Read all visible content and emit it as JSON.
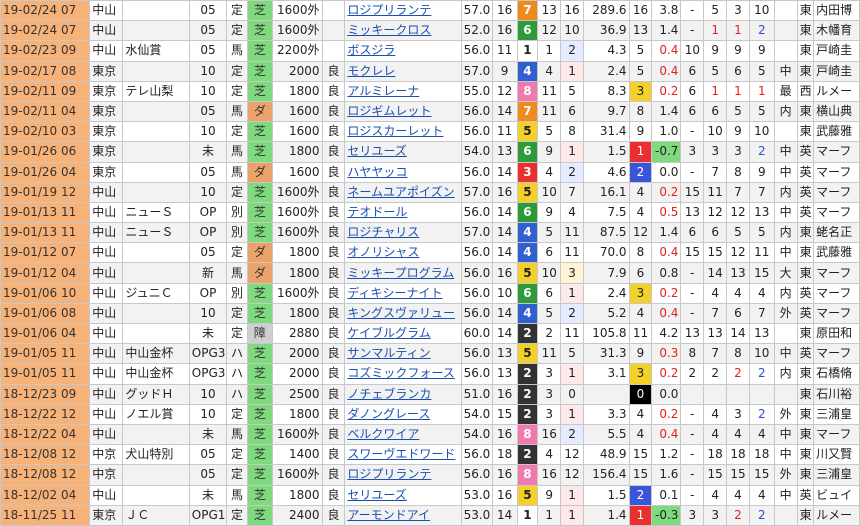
{
  "rows": [
    {
      "date": "19-02/24 07",
      "venue": "中山",
      "race": "",
      "cls": "05",
      "cond": "定",
      "surf": "芝",
      "surf_type": "turf",
      "dist": "1600外",
      "going": "",
      "horse": "ロジプリランテ",
      "wt": "57.0",
      "field": "16",
      "gate": "7",
      "no": "13",
      "pop": "16",
      "odds": "289.6",
      "fin": "16",
      "diff": "3.8",
      "p1": "-",
      "p2": "5",
      "p3": "3",
      "p4": "10",
      "style": "",
      "region": "東",
      "jockey": "内田博"
    },
    {
      "date": "19-02/24 07",
      "venue": "中山",
      "race": "",
      "cls": "05",
      "cond": "定",
      "surf": "芝",
      "surf_type": "turf",
      "dist": "1600外",
      "going": "",
      "horse": "ミッキークロス",
      "wt": "52.0",
      "field": "16",
      "gate": "6",
      "no": "12",
      "pop": "10",
      "odds": "36.9",
      "fin": "13",
      "diff": "1.4",
      "p1": "-",
      "p2": "1",
      "p3": "1",
      "p4": "2",
      "style": "",
      "region": "東",
      "jockey": "木幡育"
    },
    {
      "date": "19-02/23 09",
      "venue": "中山",
      "race": "水仙賞",
      "cls": "05",
      "cond": "馬",
      "surf": "芝",
      "surf_type": "turf",
      "dist": "2200外",
      "going": "",
      "horse": "ボスジラ",
      "wt": "56.0",
      "field": "11",
      "gate": "1",
      "no": "1",
      "pop": "2",
      "odds": "4.3",
      "fin": "5",
      "diff": "0.4",
      "p1": "10",
      "p2": "9",
      "p3": "9",
      "p4": "9",
      "style": "",
      "region": "東",
      "jockey": "戸崎圭"
    },
    {
      "date": "19-02/17 08",
      "venue": "東京",
      "race": "",
      "cls": "10",
      "cond": "定",
      "surf": "芝",
      "surf_type": "turf",
      "dist": "2000",
      "going": "良",
      "horse": "モクレレ",
      "wt": "57.0",
      "field": "9",
      "gate": "4",
      "no": "4",
      "pop": "1",
      "odds": "2.4",
      "fin": "5",
      "diff": "0.4",
      "p1": "6",
      "p2": "5",
      "p3": "6",
      "p4": "5",
      "style": "中",
      "region": "東",
      "jockey": "戸崎圭"
    },
    {
      "date": "19-02/11 09",
      "venue": "東京",
      "race": "テレ山梨",
      "cls": "10",
      "cond": "定",
      "surf": "芝",
      "surf_type": "turf",
      "dist": "1800",
      "going": "良",
      "horse": "アルミレーナ",
      "wt": "55.0",
      "field": "12",
      "gate": "8",
      "no": "11",
      "pop": "5",
      "odds": "8.3",
      "fin": "3",
      "diff": "0.2",
      "p1": "6",
      "p2": "1",
      "p3": "1",
      "p4": "1",
      "style": "最",
      "region": "西",
      "jockey": "ルメー"
    },
    {
      "date": "19-02/11 04",
      "venue": "東京",
      "race": "",
      "cls": "05",
      "cond": "馬",
      "surf": "ダ",
      "surf_type": "dirt",
      "dist": "1600",
      "going": "良",
      "horse": "ロジギムレット",
      "wt": "56.0",
      "field": "14",
      "gate": "7",
      "no": "11",
      "pop": "6",
      "odds": "9.7",
      "fin": "8",
      "diff": "1.4",
      "p1": "6",
      "p2": "6",
      "p3": "5",
      "p4": "5",
      "style": "内",
      "region": "東",
      "jockey": "横山典"
    },
    {
      "date": "19-02/10 03",
      "venue": "東京",
      "race": "",
      "cls": "10",
      "cond": "定",
      "surf": "芝",
      "surf_type": "turf",
      "dist": "1600",
      "going": "良",
      "horse": "ロジスカーレット",
      "wt": "56.0",
      "field": "11",
      "gate": "5",
      "no": "5",
      "pop": "8",
      "odds": "31.4",
      "fin": "9",
      "diff": "1.0",
      "p1": "-",
      "p2": "10",
      "p3": "9",
      "p4": "10",
      "style": "",
      "region": "東",
      "jockey": "武藤雅"
    },
    {
      "date": "19-01/26 06",
      "venue": "東京",
      "race": "",
      "cls": "未",
      "cond": "馬",
      "surf": "芝",
      "surf_type": "turf",
      "dist": "1800",
      "going": "良",
      "horse": "セリユーズ",
      "wt": "54.0",
      "field": "13",
      "gate": "6",
      "no": "9",
      "pop": "1",
      "odds": "1.5",
      "fin": "1",
      "diff": "-0.7",
      "p1": "3",
      "p2": "3",
      "p3": "3",
      "p4": "2",
      "style": "中",
      "region": "英",
      "jockey": "マーフ"
    },
    {
      "date": "19-01/26 04",
      "venue": "東京",
      "race": "",
      "cls": "05",
      "cond": "馬",
      "surf": "ダ",
      "surf_type": "dirt",
      "dist": "1600",
      "going": "良",
      "horse": "ハヤヤッコ",
      "wt": "56.0",
      "field": "14",
      "gate": "3",
      "no": "4",
      "pop": "2",
      "odds": "4.6",
      "fin": "2",
      "diff": "0.0",
      "p1": "-",
      "p2": "7",
      "p3": "8",
      "p4": "9",
      "style": "中",
      "region": "英",
      "jockey": "マーフ"
    },
    {
      "date": "19-01/19 12",
      "venue": "中山",
      "race": "",
      "cls": "10",
      "cond": "定",
      "surf": "芝",
      "surf_type": "turf",
      "dist": "1600外",
      "going": "良",
      "horse": "ネームユアポイズン",
      "wt": "57.0",
      "field": "16",
      "gate": "5",
      "no": "10",
      "pop": "7",
      "odds": "16.1",
      "fin": "4",
      "diff": "0.2",
      "p1": "15",
      "p2": "11",
      "p3": "7",
      "p4": "7",
      "style": "内",
      "region": "英",
      "jockey": "マーフ"
    },
    {
      "date": "19-01/13 11",
      "venue": "中山",
      "race": "ニューＳ",
      "cls": "OP",
      "cond": "別",
      "surf": "芝",
      "surf_type": "turf",
      "dist": "1600外",
      "going": "良",
      "horse": "テオドール",
      "wt": "56.0",
      "field": "14",
      "gate": "6",
      "no": "9",
      "pop": "4",
      "odds": "7.5",
      "fin": "4",
      "diff": "0.5",
      "p1": "13",
      "p2": "12",
      "p3": "12",
      "p4": "13",
      "style": "中",
      "region": "英",
      "jockey": "マーフ"
    },
    {
      "date": "19-01/13 11",
      "venue": "中山",
      "race": "ニューＳ",
      "cls": "OP",
      "cond": "別",
      "surf": "芝",
      "surf_type": "turf",
      "dist": "1600外",
      "going": "良",
      "horse": "ロジチャリス",
      "wt": "57.0",
      "field": "14",
      "gate": "4",
      "no": "5",
      "pop": "11",
      "odds": "87.5",
      "fin": "12",
      "diff": "1.4",
      "p1": "6",
      "p2": "6",
      "p3": "5",
      "p4": "5",
      "style": "内",
      "region": "東",
      "jockey": "蛯名正"
    },
    {
      "date": "19-01/12 07",
      "venue": "中山",
      "race": "",
      "cls": "05",
      "cond": "定",
      "surf": "ダ",
      "surf_type": "dirt",
      "dist": "1800",
      "going": "良",
      "horse": "オノリシャス",
      "wt": "56.0",
      "field": "14",
      "gate": "4",
      "no": "6",
      "pop": "11",
      "odds": "70.0",
      "fin": "8",
      "diff": "0.4",
      "p1": "15",
      "p2": "15",
      "p3": "12",
      "p4": "11",
      "style": "中",
      "region": "東",
      "jockey": "武藤雅"
    },
    {
      "date": "19-01/12 04",
      "venue": "中山",
      "race": "",
      "cls": "新",
      "cond": "馬",
      "surf": "ダ",
      "surf_type": "dirt",
      "dist": "1800",
      "going": "良",
      "horse": "ミッキープログラム",
      "wt": "56.0",
      "field": "16",
      "gate": "5",
      "no": "10",
      "pop": "3",
      "odds": "7.9",
      "fin": "6",
      "diff": "0.8",
      "p1": "-",
      "p2": "14",
      "p3": "13",
      "p4": "15",
      "style": "大",
      "region": "東",
      "jockey": "マーフ"
    },
    {
      "date": "19-01/06 10",
      "venue": "中山",
      "race": "ジュニＣ",
      "cls": "OP",
      "cond": "別",
      "surf": "芝",
      "surf_type": "turf",
      "dist": "1600外",
      "going": "良",
      "horse": "ディキシーナイト",
      "wt": "56.0",
      "field": "10",
      "gate": "6",
      "no": "6",
      "pop": "1",
      "odds": "2.4",
      "fin": "3",
      "diff": "0.2",
      "p1": "-",
      "p2": "4",
      "p3": "4",
      "p4": "4",
      "style": "内",
      "region": "英",
      "jockey": "マーフ"
    },
    {
      "date": "19-01/06 08",
      "venue": "中山",
      "race": "",
      "cls": "10",
      "cond": "定",
      "surf": "芝",
      "surf_type": "turf",
      "dist": "1800",
      "going": "良",
      "horse": "キングスヴァリュー",
      "wt": "56.0",
      "field": "14",
      "gate": "4",
      "no": "5",
      "pop": "2",
      "odds": "5.2",
      "fin": "4",
      "diff": "0.4",
      "p1": "-",
      "p2": "7",
      "p3": "6",
      "p4": "7",
      "style": "外",
      "region": "英",
      "jockey": "マーフ"
    },
    {
      "date": "19-01/06 04",
      "venue": "中山",
      "race": "",
      "cls": "未",
      "cond": "定",
      "surf": "障",
      "surf_type": "jump",
      "dist": "2880",
      "going": "良",
      "horse": "ケイブルグラム",
      "wt": "60.0",
      "field": "14",
      "gate": "2",
      "no": "2",
      "pop": "11",
      "odds": "105.8",
      "fin": "11",
      "diff": "4.2",
      "p1": "13",
      "p2": "13",
      "p3": "14",
      "p4": "13",
      "style": "",
      "region": "東",
      "jockey": "原田和"
    },
    {
      "date": "19-01/05 11",
      "venue": "中山",
      "race": "中山金杯",
      "cls": "OPG3",
      "cond": "ハ",
      "surf": "芝",
      "surf_type": "turf",
      "dist": "2000",
      "going": "良",
      "horse": "サンマルティン",
      "wt": "56.0",
      "field": "13",
      "gate": "5",
      "no": "11",
      "pop": "5",
      "odds": "31.3",
      "fin": "9",
      "diff": "0.3",
      "p1": "8",
      "p2": "7",
      "p3": "8",
      "p4": "10",
      "style": "中",
      "region": "英",
      "jockey": "マーフ"
    },
    {
      "date": "19-01/05 11",
      "venue": "中山",
      "race": "中山金杯",
      "cls": "OPG3",
      "cond": "ハ",
      "surf": "芝",
      "surf_type": "turf",
      "dist": "2000",
      "going": "良",
      "horse": "コズミックフォース",
      "wt": "56.0",
      "field": "13",
      "gate": "2",
      "no": "3",
      "pop": "1",
      "odds": "3.1",
      "fin": "3",
      "diff": "0.2",
      "p1": "2",
      "p2": "2",
      "p3": "2",
      "p4": "2",
      "style": "内",
      "region": "東",
      "jockey": "石橋脩"
    },
    {
      "date": "18-12/23 09",
      "venue": "中山",
      "race": "グッドＨ",
      "cls": "10",
      "cond": "ハ",
      "surf": "芝",
      "surf_type": "turf",
      "dist": "2500",
      "going": "良",
      "horse": "ノチェブランカ",
      "wt": "51.0",
      "field": "16",
      "gate": "2",
      "no": "3",
      "pop": "0",
      "odds": "",
      "fin": "0",
      "diff": "0.0",
      "p1": "",
      "p2": "",
      "p3": "",
      "p4": "",
      "style": "",
      "region": "東",
      "jockey": "石川裕"
    },
    {
      "date": "18-12/22 12",
      "venue": "中山",
      "race": "ノエル賞",
      "cls": "10",
      "cond": "定",
      "surf": "芝",
      "surf_type": "turf",
      "dist": "1800",
      "going": "良",
      "horse": "ダノングレース",
      "wt": "54.0",
      "field": "15",
      "gate": "2",
      "no": "3",
      "pop": "1",
      "odds": "3.3",
      "fin": "4",
      "diff": "0.2",
      "p1": "-",
      "p2": "4",
      "p3": "3",
      "p4": "2",
      "style": "外",
      "region": "東",
      "jockey": "三浦皇"
    },
    {
      "date": "18-12/22 04",
      "venue": "中山",
      "race": "",
      "cls": "未",
      "cond": "馬",
      "surf": "芝",
      "surf_type": "turf",
      "dist": "1600外",
      "going": "良",
      "horse": "ベルクワイア",
      "wt": "54.0",
      "field": "16",
      "gate": "8",
      "no": "16",
      "pop": "2",
      "odds": "5.5",
      "fin": "4",
      "diff": "0.4",
      "p1": "-",
      "p2": "4",
      "p3": "4",
      "p4": "4",
      "style": "中",
      "region": "東",
      "jockey": "マーフ"
    },
    {
      "date": "18-12/08 12",
      "venue": "中京",
      "race": "犬山特別",
      "cls": "05",
      "cond": "定",
      "surf": "芝",
      "surf_type": "turf",
      "dist": "1400",
      "going": "良",
      "horse": "スワーヴエドワード",
      "wt": "56.0",
      "field": "18",
      "gate": "2",
      "no": "4",
      "pop": "12",
      "odds": "48.9",
      "fin": "15",
      "diff": "1.2",
      "p1": "-",
      "p2": "18",
      "p3": "18",
      "p4": "18",
      "style": "中",
      "region": "東",
      "jockey": "川又賢"
    },
    {
      "date": "18-12/08 12",
      "venue": "中京",
      "race": "",
      "cls": "05",
      "cond": "定",
      "surf": "芝",
      "surf_type": "turf",
      "dist": "1600外",
      "going": "良",
      "horse": "ロジプリランテ",
      "wt": "56.0",
      "field": "16",
      "gate": "8",
      "no": "16",
      "pop": "12",
      "odds": "156.4",
      "fin": "15",
      "diff": "1.6",
      "p1": "-",
      "p2": "15",
      "p3": "15",
      "p4": "15",
      "style": "外",
      "region": "東",
      "jockey": "三浦皇"
    },
    {
      "date": "18-12/02 04",
      "venue": "中山",
      "race": "",
      "cls": "未",
      "cond": "馬",
      "surf": "芝",
      "surf_type": "turf",
      "dist": "1800",
      "going": "良",
      "horse": "セリユーズ",
      "wt": "53.0",
      "field": "16",
      "gate": "5",
      "no": "9",
      "pop": "1",
      "odds": "1.5",
      "fin": "2",
      "diff": "0.1",
      "p1": "-",
      "p2": "4",
      "p3": "4",
      "p4": "4",
      "style": "中",
      "region": "英",
      "jockey": "ビュイ"
    },
    {
      "date": "18-11/25 11",
      "venue": "東京",
      "race": "ＪＣ",
      "cls": "OPG1",
      "cond": "定",
      "surf": "芝",
      "surf_type": "turf",
      "dist": "2400",
      "going": "良",
      "horse": "アーモンドアイ",
      "wt": "53.0",
      "field": "14",
      "gate": "1",
      "no": "1",
      "pop": "1",
      "odds": "1.4",
      "fin": "1",
      "diff": "-0.3",
      "p1": "3",
      "p2": "3",
      "p3": "2",
      "p4": "2",
      "style": "",
      "region": "東",
      "jockey": "ルメー"
    }
  ]
}
